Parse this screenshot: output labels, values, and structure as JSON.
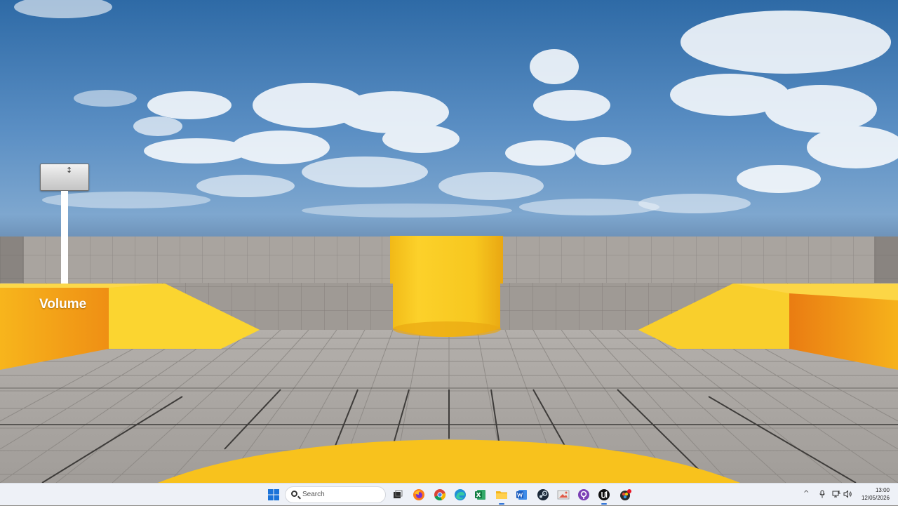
{
  "hud": {
    "volume_label": "Volume"
  },
  "taskbar": {
    "search_placeholder": "Search",
    "apps": [
      {
        "name": "start-icon"
      },
      {
        "name": "search-icon"
      },
      {
        "name": "task-view-icon"
      },
      {
        "name": "firefox-icon"
      },
      {
        "name": "chrome-icon"
      },
      {
        "name": "edge-icon"
      },
      {
        "name": "excel-icon"
      },
      {
        "name": "file-explorer-icon"
      },
      {
        "name": "word-icon"
      },
      {
        "name": "steam-icon"
      },
      {
        "name": "paint-icon"
      },
      {
        "name": "app-icon"
      },
      {
        "name": "unreal-engine-icon"
      },
      {
        "name": "davinci-icon"
      }
    ],
    "tray": {
      "chevron": "^"
    },
    "clock": {
      "time": "13:00",
      "date": "12/05/2026"
    }
  },
  "colors": {
    "accent_yellow": "#f7c31c",
    "accent_orange": "#f09a14",
    "sky_top": "#2f6aa5",
    "taskbar": "#eef1f7"
  }
}
